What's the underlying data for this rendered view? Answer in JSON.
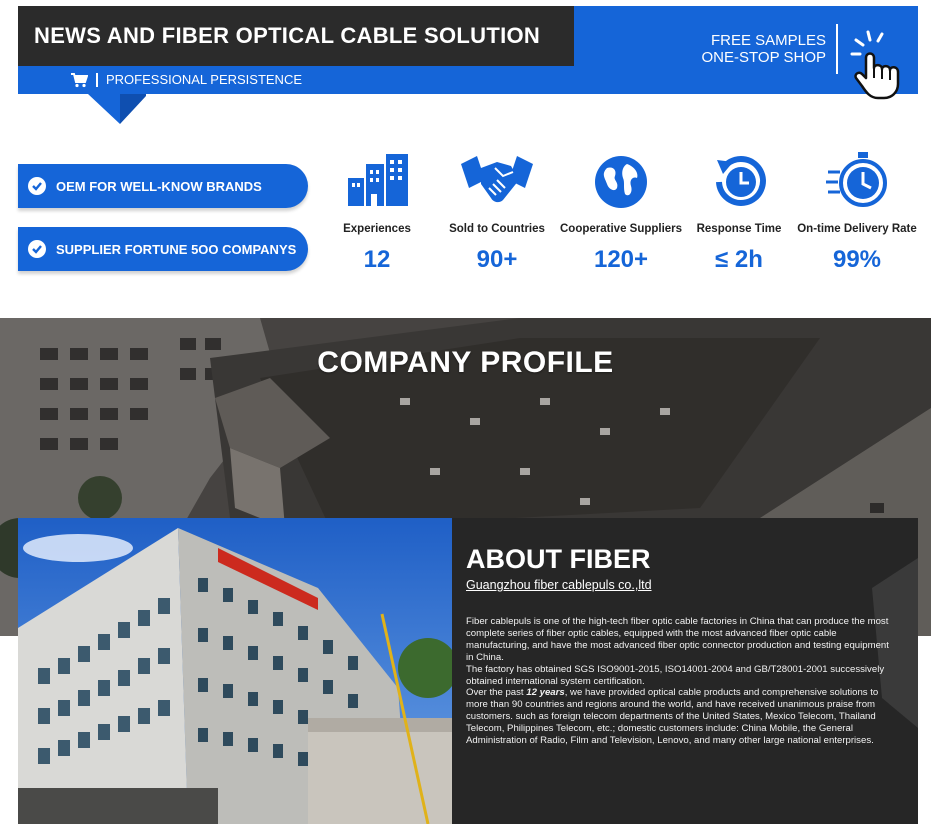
{
  "header": {
    "title": "NEWS AND FIBER OPTICAL CABLE SOLUTION",
    "subtitle": "PROFESSIONAL PERSISTENCE",
    "promo_line1": "FREE SAMPLES",
    "promo_line2": "ONE-STOP SHOP",
    "icons": [
      "cart-icon",
      "pointing-hand-icon"
    ]
  },
  "badges": [
    {
      "label": "OEM FOR WELL-KNOW BRANDS",
      "icon": "check-circle-icon"
    },
    {
      "label": "SUPPLIER FORTUNE 5OO COMPANYS",
      "icon": "check-circle-icon"
    }
  ],
  "stats": [
    {
      "label": "Experiences",
      "value": "12",
      "icon": "buildings-icon"
    },
    {
      "label": "Sold to Countries",
      "value": "90+",
      "icon": "handshake-icon"
    },
    {
      "label": "Cooperative Suppliers",
      "value": "120+",
      "icon": "globe-icon"
    },
    {
      "label": "Response Time",
      "value": "≤ 2h",
      "icon": "clock-cycle-icon"
    },
    {
      "label": "On-time Delivery Rate",
      "value": "99%",
      "icon": "stopwatch-icon"
    }
  ],
  "company": {
    "title": "COMPANY PROFILE"
  },
  "about": {
    "title": "ABOUT FIBER",
    "subtitle": "Guangzhou fiber cablepuls co.,ltd",
    "para1": "Fiber cablepuls is one of the high-tech fiber optic cable factories in China that can produce the most complete series of fiber optic cables, equipped with the most advanced fiber optic cable manufacturing, and have the most advanced fiber optic connector production and testing equipment in China.",
    "para2": "The factory has obtained SGS ISO9001-2015, ISO14001-2004 and GB/T28001-2001 successively obtained international system certification.",
    "para3_prefix": "Over the past ",
    "para3_emphasis": "12 years",
    "para3_rest": ", we have provided optical cable products and comprehensive solutions to more than 90 countries and regions around the world, and have received unanimous praise from customers. such as foreign telecom departments of the United States, Mexico Telecom, Thailand Telecom, Philippines Telecom, etc.; domestic customers include: China Mobile, the General Administration of Radio, Film and Television, Lenovo, and many other large national enterprises."
  },
  "colors": {
    "brand_blue": "#1565d8",
    "dark": "#2b2b2b",
    "panel": "#262626"
  }
}
